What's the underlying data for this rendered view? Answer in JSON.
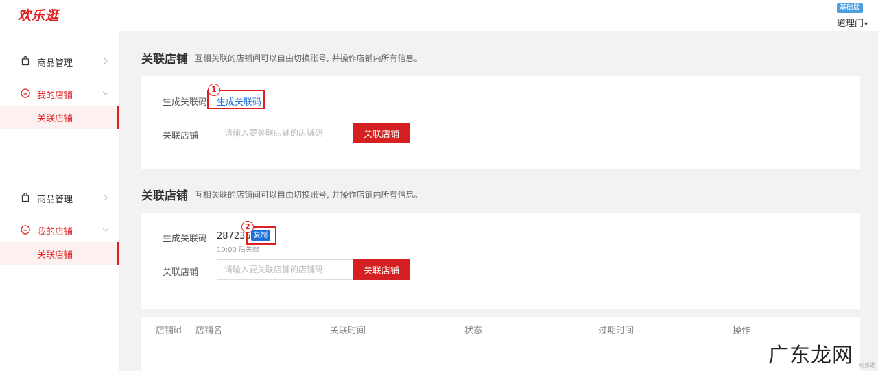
{
  "header": {
    "logo": "欢乐逛",
    "plan_badge": "基础版",
    "user_name": "道理门",
    "caret": "▾"
  },
  "sidebar_panels": [
    {
      "group_product": "商品管理",
      "group_store": "我的店铺",
      "sub_item": "关联店铺"
    },
    {
      "group_product": "商品管理",
      "group_store": "我的店铺",
      "sub_item": "关联店铺"
    }
  ],
  "section1": {
    "title": "关联店铺",
    "desc": "互相关联的店铺间可以自由切换账号, 并操作店铺内所有信息。",
    "gen_label": "生成关联码",
    "gen_link": "生成关联码",
    "marker": "1",
    "link_label": "关联店铺",
    "input_placeholder": "请输入要关联店铺的店铺码",
    "link_button": "关联店铺"
  },
  "section2": {
    "title": "关联店铺",
    "desc": "互相关联的店铺间可以自由切换账号, 并操作店铺内所有信息。",
    "gen_label": "生成关联码",
    "code_value": "287236",
    "copy_button": "复制",
    "marker": "2",
    "expire_text": "10:00 后失效",
    "link_label": "关联店铺",
    "input_placeholder": "请输入要关联店铺的店铺码",
    "link_button": "关联店铺"
  },
  "table": {
    "columns": [
      "店铺id",
      "店铺名",
      "关联时间",
      "状态",
      "过期时间",
      "操作"
    ]
  },
  "watermark": {
    "text": "广东龙网",
    "sub": "欢乐逛"
  },
  "colors": {
    "brand_red": "#e02020",
    "link_blue": "#1e6fd9"
  }
}
